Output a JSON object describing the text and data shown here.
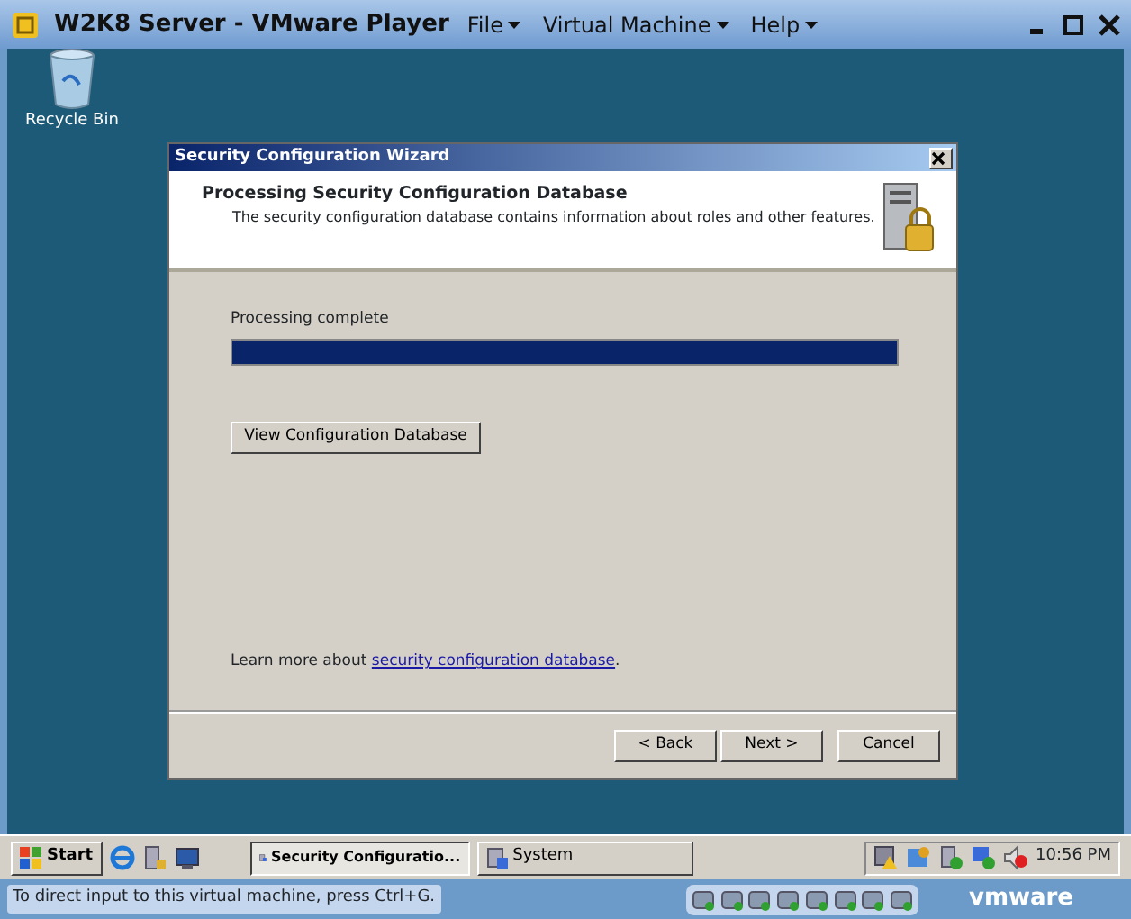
{
  "window": {
    "title": "W2K8 Server - VMware Player",
    "menus": [
      "File",
      "Virtual Machine",
      "Help"
    ]
  },
  "desktop": {
    "icons": [
      {
        "label": "Recycle Bin"
      }
    ]
  },
  "dialog": {
    "title": "Security Configuration Wizard",
    "heading": "Processing Security Configuration Database",
    "description": "The security configuration database contains information about roles and other features.",
    "status": "Processing complete",
    "progress": {
      "level": 1
    },
    "action_button": "View Configuration Database",
    "learn_more": {
      "text": "Learn more about",
      "link": "security configuration database",
      "suffix": "."
    },
    "buttons": [
      "< Back",
      "Next >",
      "Cancel"
    ]
  },
  "taskbar": {
    "start": "Start",
    "tasks": [
      {
        "label": "Security Configuratio...",
        "selected": true
      },
      {
        "label": "System",
        "selected": false
      }
    ],
    "clock": "10:56 PM"
  },
  "status_bar": {
    "hint": "To direct input to this virtual machine, press Ctrl+G.",
    "brand": "vmware"
  }
}
